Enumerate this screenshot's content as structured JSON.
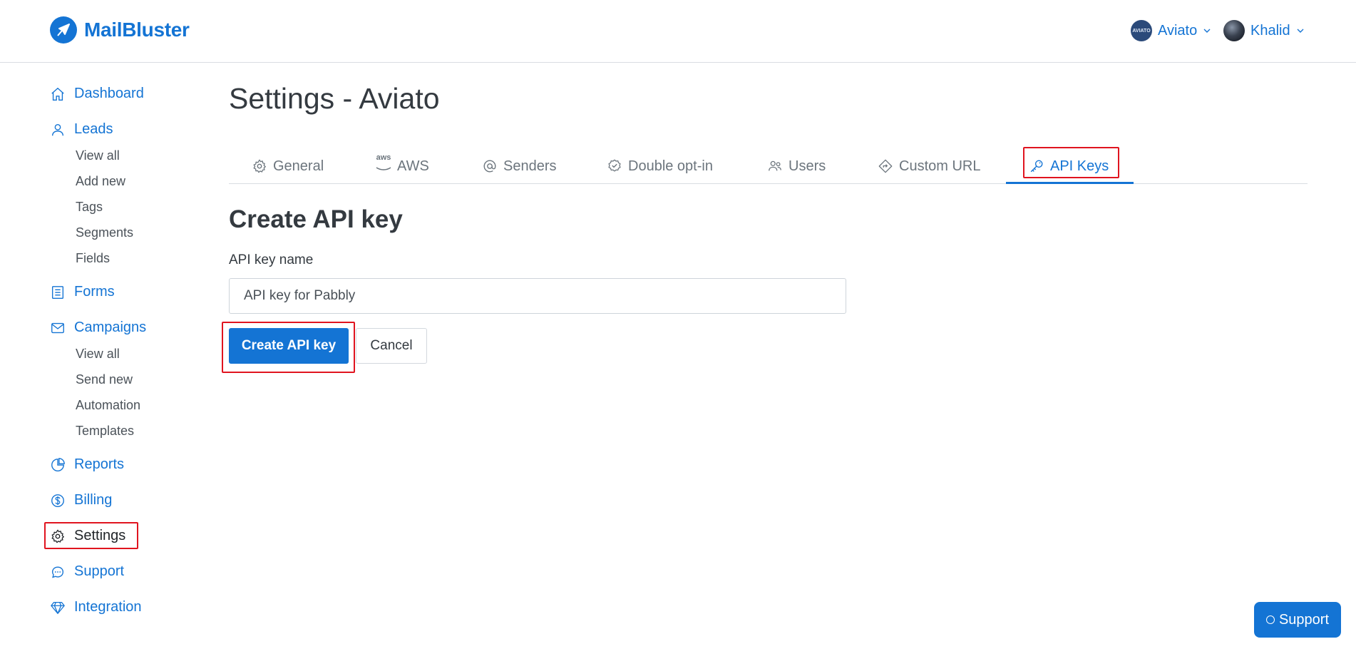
{
  "brand": {
    "name": "MailBluster",
    "accent": "#1474d4"
  },
  "header": {
    "accounts": [
      {
        "label": "Aviato",
        "avatar_text": "AVIATO"
      },
      {
        "label": "Khalid"
      }
    ]
  },
  "sidebar": {
    "dashboard": "Dashboard",
    "leads": "Leads",
    "leads_sub": [
      "View all",
      "Add new",
      "Tags",
      "Segments",
      "Fields"
    ],
    "forms": "Forms",
    "campaigns": "Campaigns",
    "campaigns_sub": [
      "View all",
      "Send new",
      "Automation",
      "Templates"
    ],
    "reports": "Reports",
    "billing": "Billing",
    "settings": "Settings",
    "support": "Support",
    "integration": "Integration"
  },
  "main": {
    "title": "Settings - Aviato",
    "tabs": [
      {
        "label": "General",
        "icon": "gear-icon"
      },
      {
        "label": "AWS",
        "icon": "aws-icon"
      },
      {
        "label": "Senders",
        "icon": "at-icon"
      },
      {
        "label": "Double opt-in",
        "icon": "check-circle-icon"
      },
      {
        "label": "Users",
        "icon": "users-icon"
      },
      {
        "label": "Custom URL",
        "icon": "diamond-arrow-icon"
      },
      {
        "label": "API Keys",
        "icon": "key-icon",
        "active": true
      }
    ],
    "section_title": "Create API key",
    "field_label": "API key name",
    "field_value": "API key for Pabbly",
    "create_button": "Create API key",
    "cancel_button": "Cancel"
  },
  "support_fab": "Support",
  "colors": {
    "highlight": "#e0141f",
    "primary": "#1474d4"
  }
}
